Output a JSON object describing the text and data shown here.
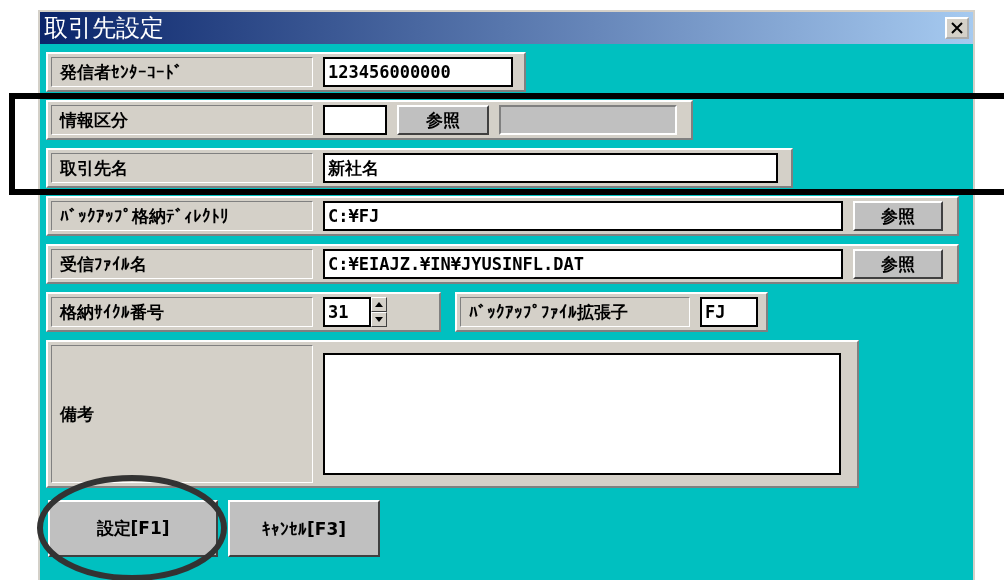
{
  "window": {
    "title": "取引先設定"
  },
  "rows": [
    {
      "fields": [
        {
          "kind": "text",
          "label": "発信者ｾﾝﾀｰｺｰﾄﾞ",
          "value": "123456000000"
        }
      ]
    },
    {
      "boxed": true,
      "fields": [
        {
          "kind": "lookup",
          "label": "情報区分",
          "button": "参照"
        }
      ]
    },
    {
      "boxed": true,
      "fields": [
        {
          "kind": "text",
          "label": "取引先名",
          "value": "新社名"
        }
      ]
    },
    {
      "fields": [
        {
          "kind": "browse",
          "label": "ﾊﾞｯｸｱｯﾌﾟ格納ﾃﾞｨﾚｸﾄﾘ",
          "value": "C:¥FJ",
          "button": "参照"
        }
      ]
    },
    {
      "fields": [
        {
          "kind": "browse",
          "label": "受信ﾌｧｲﾙ名",
          "value": "C:¥EIAJZ.¥IN¥JYUSINFL.DAT",
          "button": "参照"
        }
      ]
    },
    {
      "fields": [
        {
          "kind": "spinner",
          "label": "格納ｻｲｸﾙ番号",
          "value": "31"
        },
        {
          "kind": "short",
          "label": "ﾊﾞｯｸｱｯﾌﾟﾌｧｲﾙ拡張子",
          "value": "FJ"
        }
      ]
    },
    {
      "fields": [
        {
          "kind": "memo",
          "label": "備考"
        }
      ]
    }
  ],
  "buttons": [
    {
      "label": "設定[F1]",
      "circled": true
    },
    {
      "label": "ｷｬﾝｾﾙ[F3]",
      "circled": false
    }
  ]
}
